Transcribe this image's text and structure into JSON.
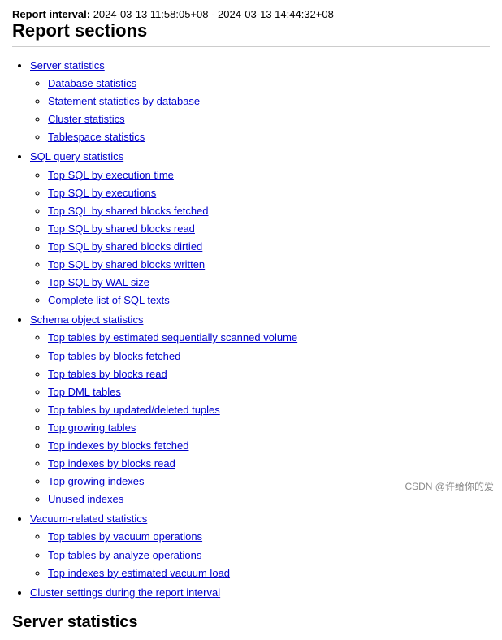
{
  "header": {
    "report_interval_label": "Report interval:",
    "interval_value": "2024-03-13 11:58:05+08 - 2024-03-13 14:44:32+08"
  },
  "report_sections_title": "Report sections",
  "server_statistics_title": "Server statistics",
  "sections": [
    {
      "label": "Server statistics",
      "href": "#server-statistics",
      "subsections": [
        {
          "label": "Database statistics",
          "href": "#database-statistics"
        },
        {
          "label": "Statement statistics by database",
          "href": "#statement-statistics"
        },
        {
          "label": "Cluster statistics",
          "href": "#cluster-statistics"
        },
        {
          "label": "Tablespace statistics",
          "href": "#tablespace-statistics"
        }
      ]
    },
    {
      "label": "SQL query statistics",
      "href": "#sql-query-statistics",
      "subsections": [
        {
          "label": "Top SQL by execution time",
          "href": "#top-sql-execution-time"
        },
        {
          "label": "Top SQL by executions",
          "href": "#top-sql-executions"
        },
        {
          "label": "Top SQL by shared blocks fetched",
          "href": "#top-sql-shared-blocks-fetched"
        },
        {
          "label": "Top SQL by shared blocks read",
          "href": "#top-sql-shared-blocks-read"
        },
        {
          "label": "Top SQL by shared blocks dirtied",
          "href": "#top-sql-shared-blocks-dirtied"
        },
        {
          "label": "Top SQL by shared blocks written",
          "href": "#top-sql-shared-blocks-written"
        },
        {
          "label": "Top SQL by WAL size",
          "href": "#top-sql-wal-size"
        },
        {
          "label": "Complete list of SQL texts",
          "href": "#complete-list-sql"
        }
      ]
    },
    {
      "label": "Schema object statistics",
      "href": "#schema-object-statistics",
      "subsections": [
        {
          "label": "Top tables by estimated sequentially scanned volume",
          "href": "#top-tables-seq-scan"
        },
        {
          "label": "Top tables by blocks fetched",
          "href": "#top-tables-blocks-fetched"
        },
        {
          "label": "Top tables by blocks read",
          "href": "#top-tables-blocks-read"
        },
        {
          "label": "Top DML tables",
          "href": "#top-dml-tables"
        },
        {
          "label": "Top tables by updated/deleted tuples",
          "href": "#top-tables-updated-deleted"
        },
        {
          "label": "Top growing tables",
          "href": "#top-growing-tables"
        },
        {
          "label": "Top indexes by blocks fetched",
          "href": "#top-indexes-blocks-fetched"
        },
        {
          "label": "Top indexes by blocks read",
          "href": "#top-indexes-blocks-read"
        },
        {
          "label": "Top growing indexes",
          "href": "#top-growing-indexes"
        },
        {
          "label": "Unused indexes",
          "href": "#unused-indexes"
        }
      ]
    },
    {
      "label": "Vacuum-related statistics",
      "href": "#vacuum-related-statistics",
      "subsections": [
        {
          "label": "Top tables by vacuum operations",
          "href": "#top-tables-vacuum"
        },
        {
          "label": "Top tables by analyze operations",
          "href": "#top-tables-analyze"
        },
        {
          "label": "Top indexes by estimated vacuum load",
          "href": "#top-indexes-vacuum-load"
        }
      ]
    },
    {
      "label": "Cluster settings during the report interval",
      "href": "#cluster-settings",
      "subsections": []
    }
  ],
  "watermark": "CSDN @许给你的爱"
}
